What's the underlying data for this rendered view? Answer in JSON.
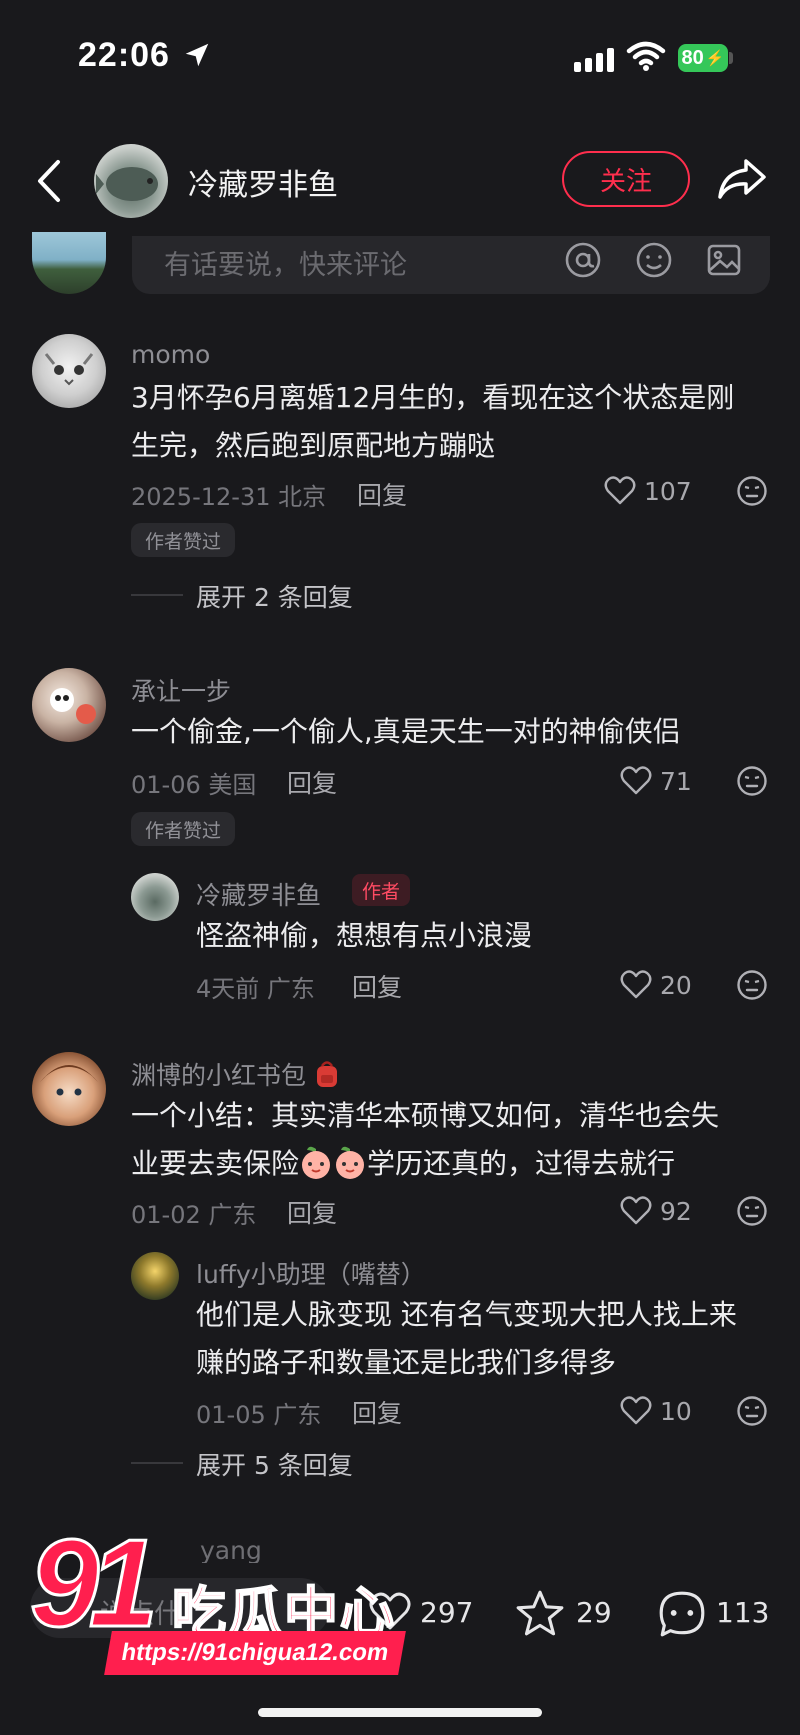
{
  "status_bar": {
    "time": "22:06",
    "battery": "80"
  },
  "header": {
    "title": "冷藏罗非鱼",
    "follow_label": "关注"
  },
  "comment_input": {
    "placeholder": "有话要说，快来评论"
  },
  "comments": [
    {
      "user": "momo",
      "text_lines": [
        "3月怀孕6月离婚12月生的，看现在这个状态是刚",
        "生完，然后跑到原配地方蹦哒"
      ],
      "date_location": "2025-12-31 北京",
      "reply_label": "回复",
      "likes": "107",
      "badge": "作者赞过",
      "expand": "展开 2 条回复"
    },
    {
      "user": "承让一步",
      "text": "一个偷金,一个偷人,真是天生一对的神偷侠侣",
      "date_location": "01-06 美国",
      "reply_label": "回复",
      "likes": "71",
      "badge": "作者赞过",
      "replies": [
        {
          "user": "冷藏罗非鱼",
          "tag": "作者",
          "text": "怪盗神偷，想想有点小浪漫",
          "date_location": "4天前 广东",
          "reply_label": "回复",
          "likes": "20"
        }
      ]
    },
    {
      "user": "渊博的小红书包",
      "text_lines": [
        "一个小结：其实清华本硕博又如何，清华也会失",
        "业要去卖保险",
        "学历还真的，过得去就行"
      ],
      "date_location": "01-02 广东",
      "reply_label": "回复",
      "likes": "92",
      "replies": [
        {
          "user": "luffy小助理（嘴替）",
          "text_lines": [
            "他们是人脉变现 还有名气变现大把人找上来",
            "赚的路子和数量还是比我们多得多"
          ],
          "date_location": "01-05 广东",
          "reply_label": "回复",
          "likes": "10"
        }
      ],
      "expand": "展开 5 条回复"
    },
    {
      "user_partial": "yang"
    }
  ],
  "bottom_bar": {
    "input_partial": "说点什",
    "likes": "297",
    "stars": "29",
    "comments": "113"
  },
  "watermark": {
    "big": "91",
    "chinese": "吃瓜中心",
    "url": "https://91chigua12.com"
  },
  "colors": {
    "background": "#19191c",
    "accent": "#ff2e4d",
    "watermark": "#ff1f4e"
  },
  "icons": [
    "location-arrow-icon",
    "signal-icon",
    "wifi-icon",
    "battery-icon",
    "back-chevron-icon",
    "share-icon",
    "at-icon",
    "emoji-icon",
    "image-icon",
    "heart-icon",
    "dislike-face-icon",
    "backpack-emoji-icon",
    "peach-emoji-icon",
    "star-icon",
    "comment-bubble-icon"
  ]
}
